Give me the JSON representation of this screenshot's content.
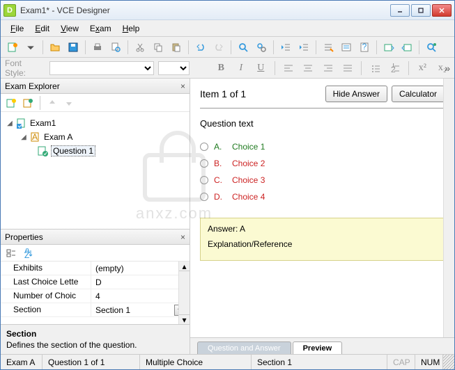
{
  "window": {
    "title": "Exam1* - VCE Designer"
  },
  "menu": {
    "file": "File",
    "edit": "Edit",
    "view": "View",
    "exam": "Exam",
    "help": "Help"
  },
  "toolbar2": {
    "font_label": "Font Style:"
  },
  "explorer": {
    "title": "Exam Explorer",
    "tree": {
      "root": "Exam1",
      "section": "Exam A",
      "question": "Question 1"
    }
  },
  "properties": {
    "title": "Properties",
    "rows": [
      {
        "name": "Exhibits",
        "value": "(empty)"
      },
      {
        "name": "Last Choice Lette",
        "value": "D"
      },
      {
        "name": "Number of Choic",
        "value": "4"
      },
      {
        "name": "Section",
        "value": "Section 1"
      }
    ],
    "desc_title": "Section",
    "desc_body": "Defines the section of the question."
  },
  "preview": {
    "item_label": "Item 1 of 1",
    "hide_answer": "Hide Answer",
    "calculator": "Calculator",
    "question_text": "Question text",
    "choices": [
      {
        "letter": "A.",
        "text": "Choice 1",
        "correct": true
      },
      {
        "letter": "B.",
        "text": "Choice 2",
        "correct": false
      },
      {
        "letter": "C.",
        "text": "Choice 3",
        "correct": false
      },
      {
        "letter": "D.",
        "text": "Choice 4",
        "correct": false
      }
    ],
    "answer_line": "Answer: A",
    "explanation_line": "Explanation/Reference"
  },
  "tabs": {
    "qa": "Question and Answer",
    "preview": "Preview"
  },
  "status": {
    "section": "Exam A",
    "position": "Question 1 of 1",
    "type": "Multiple Choice",
    "section2": "Section 1",
    "cap": "CAP",
    "num": "NUM"
  },
  "watermark": {
    "text": "anxz.com"
  }
}
